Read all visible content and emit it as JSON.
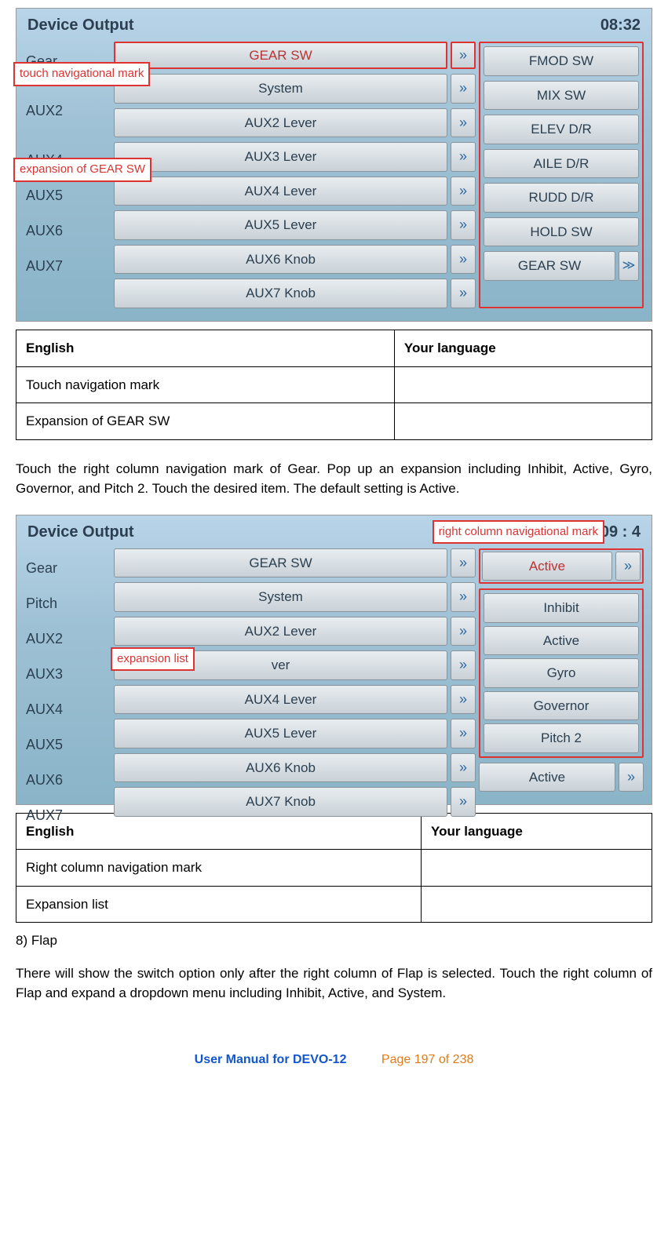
{
  "shot1": {
    "title": "Device Output",
    "time": "08:32",
    "callout_nav": "touch navigational mark",
    "callout_exp": "expansion of GEAR SW",
    "labels": [
      "Gear",
      "",
      "AUX2",
      "",
      "AUX4",
      "AUX5",
      "AUX6",
      "AUX7"
    ],
    "mid": [
      "GEAR SW",
      "System",
      "AUX2 Lever",
      "AUX3 Lever",
      "AUX4 Lever",
      "AUX5 Lever",
      "AUX6 Knob",
      "AUX7 Knob"
    ],
    "right": [
      "FMOD SW",
      "MIX SW",
      "ELEV D/R",
      "AILE D/R",
      "RUDD D/R",
      "HOLD SW",
      "GEAR SW"
    ],
    "chev_glyph": "»",
    "scroll_glyph": "≫"
  },
  "table1": {
    "h1": "English",
    "h2": "Your language",
    "r1": "Touch navigation mark",
    "r2": "Expansion of GEAR SW"
  },
  "para1": "Touch the right column navigation mark of Gear. Pop up an expansion including Inhibit, Active, Gyro, Governor, and Pitch 2. Touch the desired item. The default setting is Active.",
  "shot2": {
    "title": "Device Output",
    "time": "09 : 4",
    "callout_nav": "right column navigational mark",
    "callout_list": "expansion list",
    "labels": [
      "Gear",
      "Pitch",
      "AUX2",
      "AUX3",
      "AUX4",
      "AUX5",
      "AUX6",
      "AUX7"
    ],
    "mid": [
      "GEAR SW",
      "System",
      "AUX2 Lever",
      "ver",
      "AUX4 Lever",
      "AUX5 Lever",
      "AUX6 Knob",
      "AUX7 Knob"
    ],
    "right_top": "Active",
    "right_list": [
      "Inhibit",
      "Active",
      "Gyro",
      "Governor",
      "Pitch 2"
    ],
    "right_bottom": "Active"
  },
  "table2": {
    "h1": "English",
    "h2": "Your language",
    "r1": "Right column navigation mark",
    "r2": "Expansion list"
  },
  "heading8": "8)    Flap",
  "para2": "There will show the switch option only after the right column of Flap is selected. Touch the right column of Flap and expand a dropdown menu including Inhibit, Active, and System.",
  "footer": {
    "left": "User Manual for DEVO-12",
    "right": "Page 197 of 238"
  }
}
